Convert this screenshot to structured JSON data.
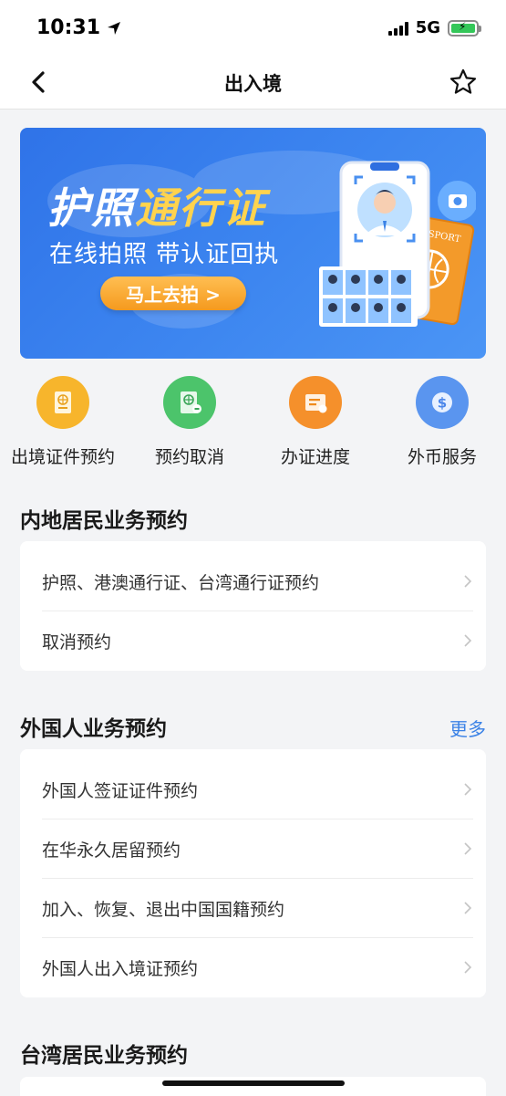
{
  "status_bar": {
    "time": "10:31",
    "network": "5G"
  },
  "nav": {
    "title": "出入境"
  },
  "banner": {
    "title_part1": "护照",
    "title_part2": "通行证",
    "subtitle": "在线拍照 带认证回执",
    "button_label": "马上去拍 >",
    "passport_text": "PASSPORT"
  },
  "quick_actions": [
    {
      "label": "出境证件预约",
      "color": "#f7b52c"
    },
    {
      "label": "预约取消",
      "color": "#4cc46b"
    },
    {
      "label": "办证进度",
      "color": "#f5902b"
    },
    {
      "label": "外币服务",
      "color": "#5a95ef"
    }
  ],
  "mainland_section": {
    "title": "内地居民业务预约",
    "items": [
      {
        "label": "护照、港澳通行证、台湾通行证预约"
      },
      {
        "label": "取消预约"
      }
    ]
  },
  "foreigner_section": {
    "title": "外国人业务预约",
    "more_label": "更多",
    "items": [
      {
        "label": "外国人签证证件预约"
      },
      {
        "label": "在华永久居留预约"
      },
      {
        "label": "加入、恢复、退出中国国籍预约"
      },
      {
        "label": "外国人出入境证预约"
      }
    ]
  },
  "taiwan_section": {
    "title": "台湾居民业务预约"
  }
}
